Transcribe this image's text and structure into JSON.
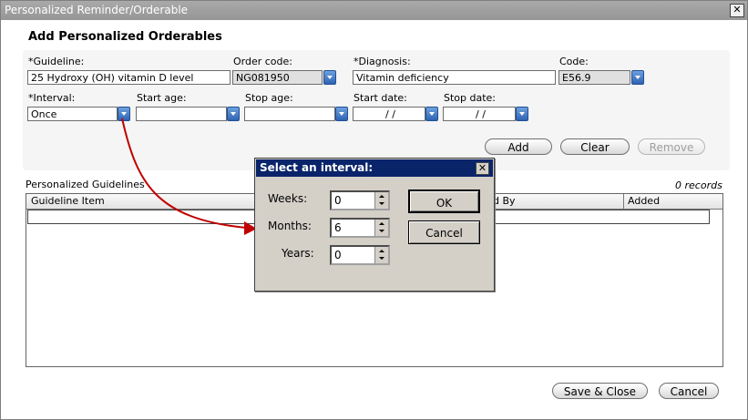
{
  "window": {
    "title": "Personalized Reminder/Orderable",
    "close_glyph": "✕"
  },
  "heading": "Add Personalized Orderables",
  "form": {
    "guideline_label": "*Guideline:",
    "guideline_value": "25 Hydroxy (OH) vitamin D level",
    "order_code_label": "Order code:",
    "order_code_value": "NG081950",
    "diagnosis_label": "*Diagnosis:",
    "diagnosis_value": "Vitamin deficiency",
    "code_label": "Code:",
    "code_value": "E56.9",
    "interval_label": "*Interval:",
    "interval_value": "Once",
    "start_age_label": "Start age:",
    "start_age_value": "",
    "stop_age_label": "Stop age:",
    "stop_age_value": "",
    "start_date_label": "Start date:",
    "start_date_value": "/ /",
    "stop_date_label": "Stop date:",
    "stop_date_value": "/ /"
  },
  "actions": {
    "add": "Add",
    "clear": "Clear",
    "remove": "Remove"
  },
  "grid": {
    "title": "Personalized Guidelines",
    "records": "0 records",
    "columns": [
      "Guideline Item",
      "d By",
      "Added"
    ]
  },
  "footer": {
    "save_close": "Save & Close",
    "cancel": "Cancel"
  },
  "dialog": {
    "title": "Select an interval:",
    "close_glyph": "✕",
    "weeks_label": "Weeks:",
    "weeks_value": "0",
    "months_label": "Months:",
    "months_value": "6",
    "years_label": "Years:",
    "years_value": "0",
    "ok": "OK",
    "cancel": "Cancel"
  },
  "colors": {
    "arrow": "#c00000",
    "dialog_title_bg": "#0a246a",
    "dropdown_blue": "#2f64b4"
  }
}
